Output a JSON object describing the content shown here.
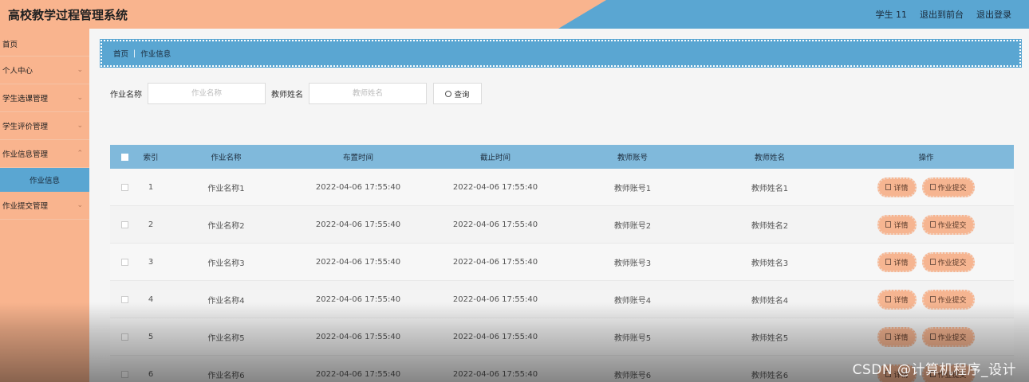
{
  "header": {
    "title": "高校教学过程管理系统",
    "user_label": "学生 11",
    "back_label": "退出到前台",
    "logout_label": "退出登录"
  },
  "sidebar": {
    "items": [
      {
        "label": "首页"
      },
      {
        "label": "个人中心"
      },
      {
        "label": "学生选课管理"
      },
      {
        "label": "学生评价管理"
      },
      {
        "label": "作业信息管理"
      },
      {
        "label": "作业信息"
      },
      {
        "label": "作业提交管理"
      }
    ]
  },
  "breadcrumb": {
    "home": "首页",
    "separator": "|",
    "current": "作业信息"
  },
  "search": {
    "name_label": "作业名称",
    "name_placeholder": "作业名称",
    "teacher_label": "教师姓名",
    "teacher_placeholder": "教师姓名",
    "button_label": "查询"
  },
  "table": {
    "columns": [
      "索引",
      "作业名称",
      "布置时间",
      "截止时间",
      "教师账号",
      "教师姓名",
      "操作"
    ],
    "rows": [
      {
        "idx": "1",
        "name": "作业名称1",
        "assigned": "2022-04-06 17:55:40",
        "deadline": "2022-04-06 17:55:40",
        "account": "教师账号1",
        "teacher": "教师姓名1"
      },
      {
        "idx": "2",
        "name": "作业名称2",
        "assigned": "2022-04-06 17:55:40",
        "deadline": "2022-04-06 17:55:40",
        "account": "教师账号2",
        "teacher": "教师姓名2"
      },
      {
        "idx": "3",
        "name": "作业名称3",
        "assigned": "2022-04-06 17:55:40",
        "deadline": "2022-04-06 17:55:40",
        "account": "教师账号3",
        "teacher": "教师姓名3"
      },
      {
        "idx": "4",
        "name": "作业名称4",
        "assigned": "2022-04-06 17:55:40",
        "deadline": "2022-04-06 17:55:40",
        "account": "教师账号4",
        "teacher": "教师姓名4"
      },
      {
        "idx": "5",
        "name": "作业名称5",
        "assigned": "2022-04-06 17:55:40",
        "deadline": "2022-04-06 17:55:40",
        "account": "教师账号5",
        "teacher": "教师姓名5"
      },
      {
        "idx": "6",
        "name": "作业名称6",
        "assigned": "2022-04-06 17:55:40",
        "deadline": "2022-04-06 17:55:40",
        "account": "教师账号6",
        "teacher": "教师姓名6"
      }
    ],
    "detail_label": "详情",
    "submit_label": "作业提交"
  },
  "watermark": "CSDN @计算机程序_设计",
  "colors": {
    "peach": "#f9b48e",
    "blue": "#5aa6d2",
    "table_header": "#80b9db",
    "op_button": "#f6b591"
  }
}
